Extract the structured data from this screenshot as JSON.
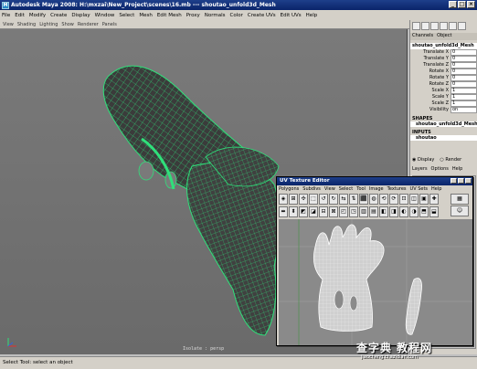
{
  "window": {
    "title": "Autodesk Maya 2008: H:\\mxzai\\New_Project\\scenes\\16.mb  ---  shoutao_unfold3d_Mesh",
    "icon_label": "M"
  },
  "main_menu": [
    "File",
    "Edit",
    "Modify",
    "Create",
    "Display",
    "Window",
    "Select",
    "Mesh",
    "Edit Mesh",
    "Proxy",
    "Normals",
    "Color",
    "Create UVs",
    "Edit UVs",
    "Help"
  ],
  "viewport": {
    "menu": [
      "View",
      "Shading",
      "Lighting",
      "Show",
      "Renderer",
      "Panels"
    ],
    "label": "Isolate : persp"
  },
  "channel_box": {
    "tabs": [
      "Channels",
      "Object"
    ],
    "object_name": "shoutao_unfold3d_Mesh",
    "attributes": [
      {
        "name": "Translate X",
        "value": "0"
      },
      {
        "name": "Translate Y",
        "value": "0"
      },
      {
        "name": "Translate Z",
        "value": "0"
      },
      {
        "name": "Rotate X",
        "value": "0"
      },
      {
        "name": "Rotate Y",
        "value": "0"
      },
      {
        "name": "Rotate Z",
        "value": "0"
      },
      {
        "name": "Scale X",
        "value": "1"
      },
      {
        "name": "Scale Y",
        "value": "1"
      },
      {
        "name": "Scale Z",
        "value": "1"
      },
      {
        "name": "Visibility",
        "value": "on"
      }
    ],
    "shapes_header": "SHAPES",
    "shape_name": "shoutao_unfold3d_MeshSh",
    "inputs_header": "INPUTS",
    "input_name": "shoutao",
    "display_radio": "Display",
    "render_radio": "Render",
    "layer_tabs": [
      "Layers",
      "Options",
      "Help"
    ]
  },
  "uv_editor": {
    "title": "UV Texture Editor",
    "menu": [
      "Polygons",
      "Subdivs",
      "View",
      "Select",
      "Tool",
      "Image",
      "Textures",
      "UV Sets",
      "Help"
    ]
  },
  "help_line": "Select Tool: select an object",
  "watermark": {
    "main": "查字典 教程网",
    "sub": "jiaocheng.chazidian.com"
  },
  "colors": {
    "mesh_wire": "#2fe07a",
    "mesh_fill": "#3a3a3a",
    "viewport_bg": "#757575",
    "title_bar": "#0a246a"
  }
}
